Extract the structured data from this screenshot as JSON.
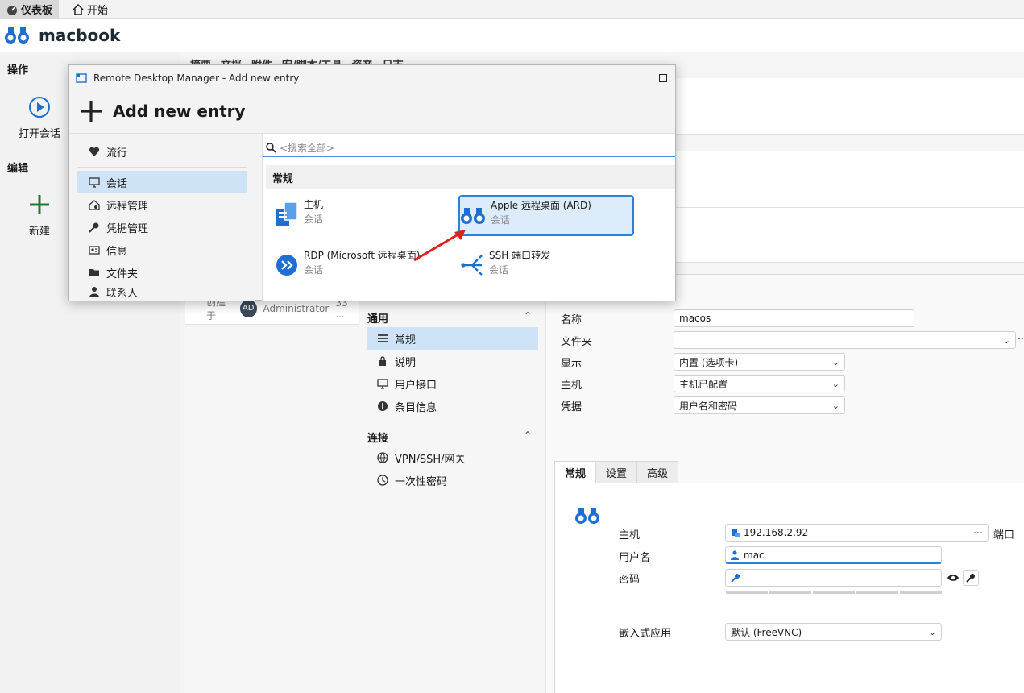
{
  "top_tabs": [
    {
      "label": "仪表板",
      "icon": "dashboard-icon"
    },
    {
      "label": "开始",
      "icon": "home-icon"
    }
  ],
  "header": {
    "title": "macbook",
    "icon": "binoculars-icon"
  },
  "left_pane": {
    "section_actions": "操作",
    "open_session": "打开会话",
    "section_edit": "编辑",
    "new": "新建"
  },
  "main_tabs": [
    "摘要",
    "文档",
    "附件",
    "宏/脚本/工具",
    "资产",
    "日志"
  ],
  "meta": {
    "created_label": "创建于",
    "avatar_initials": "AD",
    "user": "Administrator",
    "time": "33 ..."
  },
  "properties": {
    "nav_general_header": "通用",
    "nav_general_items": [
      "常规",
      "说明",
      "用户接口",
      "条目信息"
    ],
    "nav_connection_header": "连接",
    "nav_connection_items": [
      "VPN/SSH/网关",
      "一次性密码"
    ],
    "form": {
      "name_label": "名称",
      "name_value": "macos",
      "folder_label": "文件夹",
      "folder_value": "",
      "display_label": "显示",
      "display_value": "内置 (选项卡)",
      "host_label": "主机",
      "host_value": "主机已配置",
      "cred_label": "凭据",
      "cred_value": "用户名和密码"
    },
    "sub_tabs": [
      "常规",
      "设置",
      "高级"
    ],
    "general": {
      "host_label": "主机",
      "host_value": "192.168.2.92",
      "port_label": "端口",
      "user_label": "用户名",
      "user_value": "mac",
      "password_label": "密码",
      "password_value": "",
      "embedded_label": "嵌入式应用",
      "embedded_value": "默认 (FreeVNC)"
    }
  },
  "dialog": {
    "window_title": "Remote Desktop Manager - Add new entry",
    "heading": "Add new entry",
    "categories": [
      {
        "label": "流行",
        "icon": "heart-icon"
      },
      {
        "label": "会话",
        "icon": "monitor-icon"
      },
      {
        "label": "远程管理",
        "icon": "remote-management-icon"
      },
      {
        "label": "凭据管理",
        "icon": "key-icon"
      },
      {
        "label": "信息",
        "icon": "id-card-icon"
      },
      {
        "label": "文件夹",
        "icon": "folder-icon"
      },
      {
        "label": "联系人",
        "icon": "contact-icon"
      }
    ],
    "search_placeholder": "<搜索全部>",
    "group_title": "常规",
    "entries": [
      {
        "title": "主机",
        "subtitle": "会话",
        "icon": "host-icon"
      },
      {
        "title": "Apple 远程桌面 (ARD)",
        "subtitle": "会话",
        "icon": "binoculars-icon"
      },
      {
        "title": "RDP (Microsoft 远程桌面)",
        "subtitle": "会话",
        "icon": "rdp-icon"
      },
      {
        "title": "SSH 端口转发",
        "subtitle": "会话",
        "icon": "ssh-forward-icon"
      }
    ]
  },
  "colors": {
    "accent": "#2f7fd2",
    "selection": "#cfe3f6",
    "arrow": "#e0201b",
    "new_plus": "#1f7a3a"
  }
}
